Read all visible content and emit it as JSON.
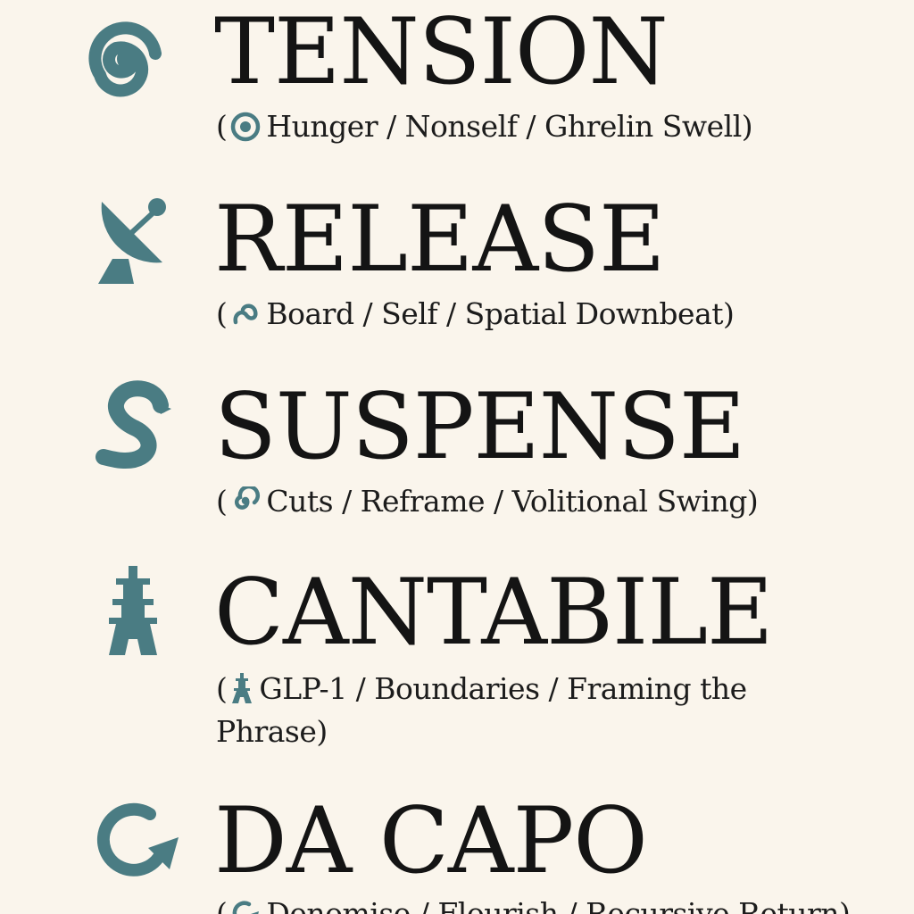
{
  "colors": {
    "background": "#faf5ec",
    "icon_teal": "#4a7c83",
    "text": "#161616"
  },
  "sections": [
    {
      "title": "TENSION",
      "icon": "spiral-icon",
      "small_icon": "target-icon",
      "open_paren": "(",
      "subtitle": "Hunger / Nonself / Ghrelin Swell",
      "close_paren": ")"
    },
    {
      "title": "RELEASE",
      "icon": "satellite-dish-icon",
      "small_icon": "loop-icon",
      "open_paren": "(",
      "subtitle": "Board / Self / Spatial Downbeat",
      "close_paren": ")"
    },
    {
      "title": "SUSPENSE",
      "icon": "serpent-icon",
      "small_icon": "spiral-icon",
      "open_paren": "(",
      "subtitle": "Cuts / Reframe / Volitional Swing",
      "close_paren": ")"
    },
    {
      "title": "CANTABILE",
      "icon": "tower-icon",
      "small_icon": "tower-icon",
      "open_paren": "(",
      "subtitle": "GLP-1 / Boundaries / Framing the Phrase",
      "close_paren": ")"
    },
    {
      "title": "DA CAPO",
      "icon": "return-arrow-icon",
      "small_icon": "return-arrow-icon",
      "open_paren": "(",
      "subtitle": "Denomise / Flourish / Recursive Return",
      "close_paren": ")"
    }
  ]
}
